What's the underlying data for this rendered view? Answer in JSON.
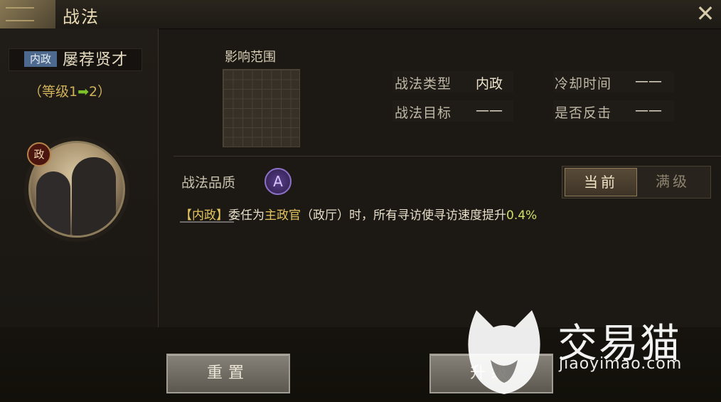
{
  "window": {
    "title": "战法",
    "close_label": "✕"
  },
  "skill": {
    "category_tag": "内政",
    "name": "屡荐贤才",
    "level_prefix": "（等级1",
    "level_arrow": "➡",
    "level_suffix": "2）",
    "portrait_badge": "政"
  },
  "range": {
    "label": "影响范围"
  },
  "attributes": {
    "type_label": "战法类型",
    "type_value": "内政",
    "cooldown_label": "冷却时间",
    "cooldown_value": "——",
    "target_label": "战法目标",
    "target_value": "——",
    "counter_label": "是否反击",
    "counter_value": "——"
  },
  "quality": {
    "label": "战法品质",
    "grade": "A"
  },
  "tabs": {
    "current": "当前",
    "max": "满级"
  },
  "description": {
    "tag": "【内政】",
    "part1": "委任为",
    "highlight": "主政官",
    "part2": "（政厅）时，所有寻访使寻访速度提升",
    "percent": "0.4%"
  },
  "buttons": {
    "reset": "重置",
    "upgrade": "升级"
  },
  "watermark": {
    "name": "交易猫",
    "url": "jiaoyimao.com"
  },
  "colors": {
    "accent_gold": "#e3c45e",
    "level_green": "#7cc02c",
    "tag_blue": "#4d6a8e",
    "quality_purple": "#5b3d8c"
  }
}
